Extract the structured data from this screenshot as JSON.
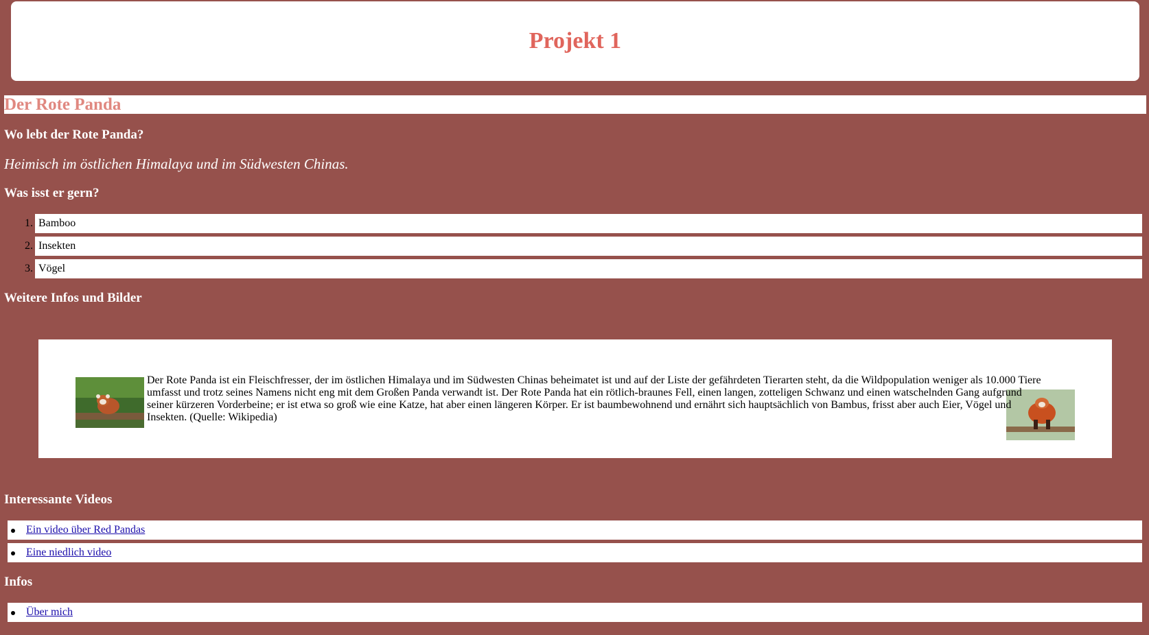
{
  "header": {
    "title": "Projekt 1"
  },
  "section_title": "Der Rote Panda",
  "q1": "Wo lebt der Rote Panda?",
  "a1": "Heimisch im östlichen Himalaya und im Südwesten Chinas.",
  "q2": "Was isst er gern?",
  "food_list": [
    {
      "num": "1.",
      "label": "Bamboo"
    },
    {
      "num": "2.",
      "label": "Insekten"
    },
    {
      "num": "3.",
      "label": "Vögel"
    }
  ],
  "more_heading": "Weitere Infos und Bilder",
  "info_text": "Der Rote Panda ist ein Fleischfresser, der im östlichen Himalaya und im Südwesten Chinas beheimatet ist und auf der Liste der gefährdeten Tierarten steht, da die Wildpopulation weniger als 10.000 Tiere umfasst und trotz seines Namens nicht eng mit dem Großen Panda verwandt ist. Der Rote Panda hat ein rötlich-braunes Fell, einen langen, zotteligen Schwanz und einen watschelnden Gang aufgrund seiner kürzeren Vorderbeine; er ist etwa so groß wie eine Katze, hat aber einen längeren Körper. Er ist baumbewohnend und ernährt sich hauptsächlich von Bambus, frisst aber auch Eier, Vögel und Insekten. (Quelle: Wikipedia)",
  "videos_heading": "Interessante Videos",
  "videos": [
    {
      "label": "Ein video über Red Pandas"
    },
    {
      "label": "Eine niedlich video"
    }
  ],
  "infos_heading": "Infos",
  "infos": [
    {
      "label": "Über mich"
    }
  ],
  "colors": {
    "background": "#96514c",
    "title_accent": "#e0655c",
    "section_accent": "#e08880",
    "link": "#1a0dab"
  }
}
